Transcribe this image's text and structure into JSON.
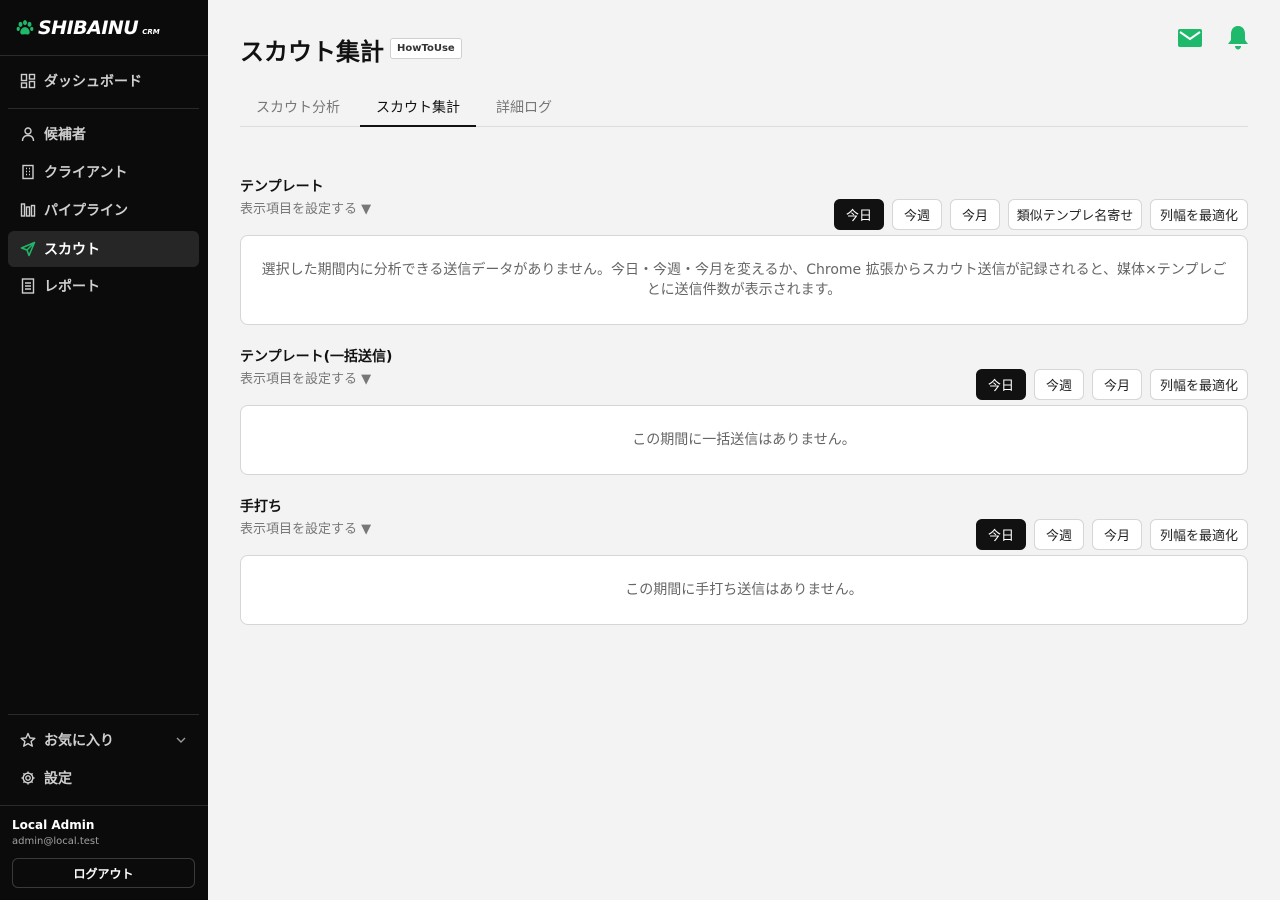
{
  "sidebar": {
    "logo": {
      "text": "SHIBAINU",
      "sub": "CRM"
    },
    "items": [
      {
        "label": "ダッシュボード",
        "icon": "dashboard-icon"
      },
      {
        "label": "候補者",
        "icon": "user-icon"
      },
      {
        "label": "クライアント",
        "icon": "building-icon"
      },
      {
        "label": "パイプライン",
        "icon": "pipeline-icon"
      },
      {
        "label": "スカウト",
        "icon": "send-icon",
        "active": true
      },
      {
        "label": "レポート",
        "icon": "report-icon"
      }
    ],
    "favorites": {
      "label": "お気に入り",
      "icon": "star-icon"
    },
    "settings": {
      "label": "設定",
      "icon": "gear-icon"
    },
    "user": {
      "name": "Local Admin",
      "email": "admin@local.test"
    },
    "logout_label": "ログアウト"
  },
  "header": {
    "title": "スカウト集計",
    "howto_label": "HowToUse",
    "accent_color": "#1fb96b"
  },
  "tabs": [
    {
      "label": "スカウト分析"
    },
    {
      "label": "スカウト集計",
      "active": true
    },
    {
      "label": "詳細ログ"
    }
  ],
  "sections": [
    {
      "title": "テンプレート",
      "settings_link": "表示項目を設定する ▼",
      "buttons": [
        "今日",
        "今週",
        "今月",
        "類似テンプレ名寄せ",
        "列幅を最適化"
      ],
      "selected_button": "今日",
      "empty_message": "選択した期間内に分析できる送信データがありません。今日・今週・今月を変えるか、Chrome 拡張からスカウト送信が記録されると、媒体×テンプレごとに送信件数が表示されます。"
    },
    {
      "title": "テンプレート(一括送信)",
      "settings_link": "表示項目を設定する ▼",
      "buttons": [
        "今日",
        "今週",
        "今月",
        "列幅を最適化"
      ],
      "selected_button": "今日",
      "empty_message": "この期間に一括送信はありません。"
    },
    {
      "title": "手打ち",
      "settings_link": "表示項目を設定する ▼",
      "buttons": [
        "今日",
        "今週",
        "今月",
        "列幅を最適化"
      ],
      "selected_button": "今日",
      "empty_message": "この期間に手打ち送信はありません。"
    }
  ]
}
